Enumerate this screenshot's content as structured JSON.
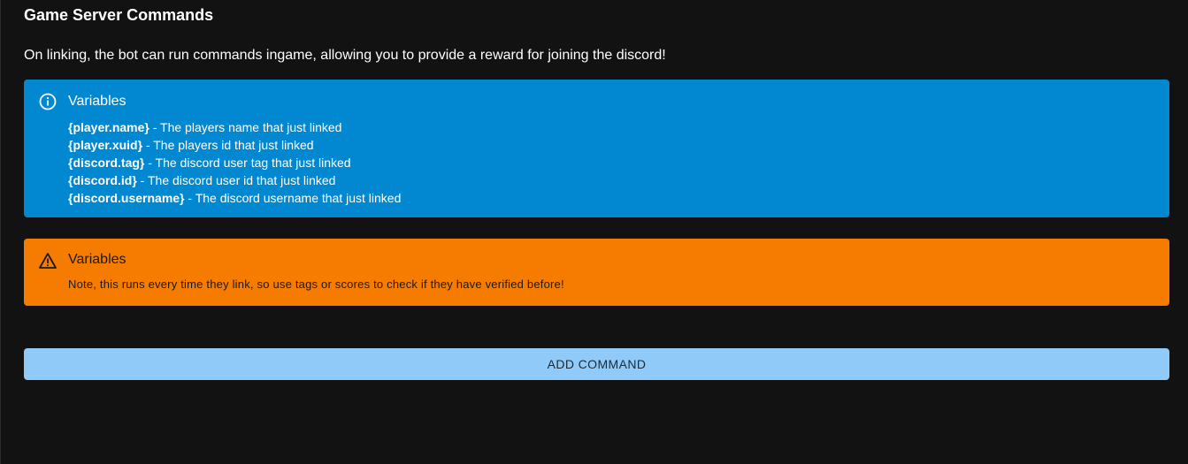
{
  "section": {
    "title": "Game Server Commands",
    "description": "On linking, the bot can run commands ingame, allowing you to provide a reward for joining the discord!"
  },
  "info_alert": {
    "icon": "info-icon",
    "color": "#0288d1",
    "title": "Variables",
    "variables": [
      {
        "name": "{player.name}",
        "desc": " - The players name that just linked"
      },
      {
        "name": "{player.xuid}",
        "desc": " - The players id that just linked"
      },
      {
        "name": "{discord.tag}",
        "desc": " - The discord user tag that just linked"
      },
      {
        "name": "{discord.id}",
        "desc": " - The discord user id that just linked"
      },
      {
        "name": "{discord.username}",
        "desc": " - The discord username that just linked"
      }
    ]
  },
  "warning_alert": {
    "icon": "warning-icon",
    "color": "#f57c00",
    "title": "Variables",
    "body": "Note, this runs every time they link, so use tags or scores to check if they have verified before!"
  },
  "actions": {
    "add_command_label": "ADD COMMAND",
    "add_command_color": "#90caf9"
  }
}
